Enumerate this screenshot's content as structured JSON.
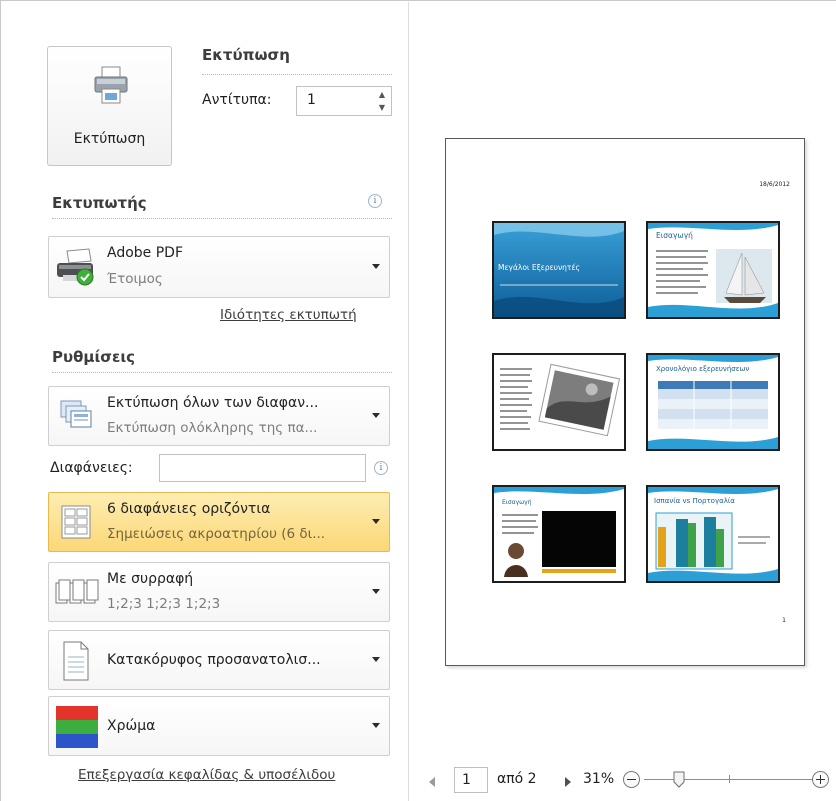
{
  "print_button": {
    "label": "Εκτύπωση",
    "icon": "printer-icon"
  },
  "print_section": {
    "title": "Εκτύπωση",
    "copies_label": "Αντίτυπα:",
    "copies_value": "1"
  },
  "printer_section": {
    "title": "Εκτυπωτής",
    "printer_name": "Adobe PDF",
    "printer_status": "Έτοιμος",
    "properties_link": "Ιδιότητες εκτυπωτή"
  },
  "settings_section": {
    "title": "Ρυθμίσεις",
    "print_range": {
      "title": "Εκτύπωση όλων των διαφαν...",
      "subtitle": "Εκτύπωση ολόκληρης της πα..."
    },
    "slides_label": "Διαφάνειες:",
    "slides_value": "",
    "layout": {
      "title": "6 διαφάνειες οριζόντια",
      "subtitle": "Σημειώσεις ακροατηρίου (6 δι..."
    },
    "collation": {
      "title": "Με συρραφή",
      "subtitle": "1;2;3   1;2;3   1;2;3"
    },
    "orientation": {
      "title": "Κατακόρυφος προσανατολισ..."
    },
    "color": {
      "title": "Χρώμα"
    },
    "header_footer_link": "Επεξεργασία κεφαλίδας & υποσέλιδου"
  },
  "preview": {
    "date": "18/6/2012",
    "page_number": "1",
    "slides": [
      {
        "title": "Μεγάλοι Εξερευνητές"
      },
      {
        "title": "Εισαγωγή"
      },
      {
        "title": ""
      },
      {
        "title": "Χρονολόγιο εξερευνήσεων"
      },
      {
        "title": "Εισαγωγή"
      },
      {
        "title": "Ισπανία vs Πορτογαλία"
      }
    ]
  },
  "navigation": {
    "current_page": "1",
    "of_label": "από 2",
    "zoom": "31%"
  },
  "colors": {
    "highlight_top": "#fdeeb2",
    "highlight_bottom": "#fbd778",
    "slide_blue": "#1f78b4"
  }
}
